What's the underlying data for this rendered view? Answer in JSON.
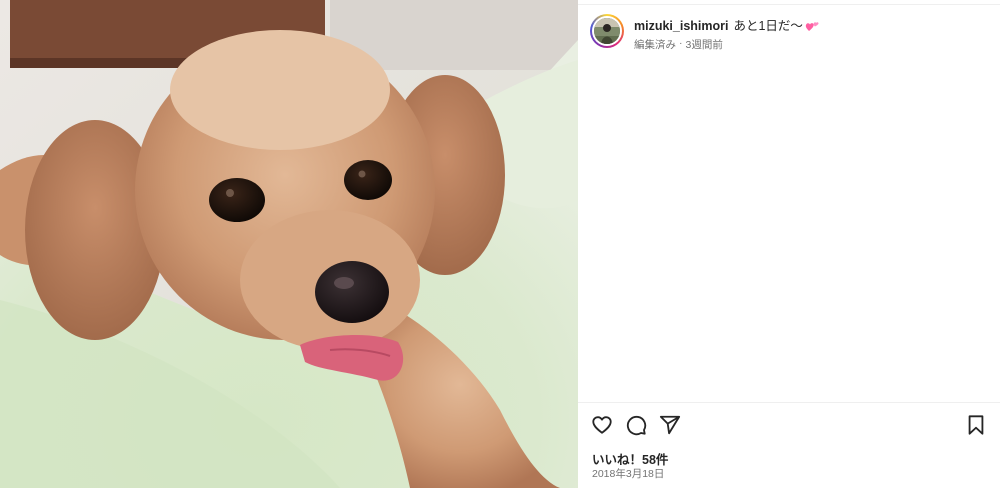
{
  "post": {
    "image_alt": "Toy poodle lying on a mint green fluffy blanket with its tongue out",
    "username": "mizuki_ishimori",
    "caption": "あと1日だ〜",
    "caption_emoji": "two-hearts-emoji",
    "edited_label": "編集済み",
    "separator": "·",
    "relative_time": "3週間前",
    "likes_text": "いいね！58件",
    "date_text": "2018年3月18日"
  },
  "actions": {
    "like_icon": "heart-outline-icon",
    "comment_icon": "comment-bubble-icon",
    "share_icon": "paper-plane-icon",
    "save_icon": "bookmark-outline-icon"
  },
  "colors": {
    "text_primary": "#262626",
    "text_secondary": "#737373",
    "avatar_ring_start": "#fdd835",
    "avatar_ring_end": "#dd2a7b",
    "emoji_pink": "#ff5fa2"
  }
}
